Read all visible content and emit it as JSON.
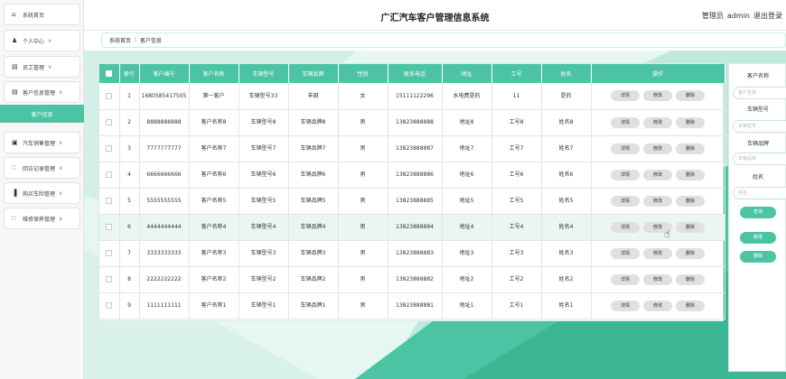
{
  "sidebar": {
    "items": [
      {
        "label": "系统首页",
        "icon": "home-icon",
        "glyph": "⌂",
        "chev": ""
      },
      {
        "label": "个人中心",
        "icon": "user-icon",
        "glyph": "♟",
        "chev": "∨"
      },
      {
        "label": "员工管理",
        "icon": "staff-icon",
        "glyph": "▤",
        "chev": "∨"
      },
      {
        "label": "客户信息管理",
        "icon": "customer-icon",
        "glyph": "▤",
        "chev": "∧"
      },
      {
        "label": "汽车销售管理",
        "icon": "car-sales-icon",
        "glyph": "▣",
        "chev": "∨"
      },
      {
        "label": "回访记录管理",
        "icon": "grid-icon",
        "glyph": "∷",
        "chev": "∨"
      },
      {
        "label": "购买车险管理",
        "icon": "chart-icon",
        "glyph": "▐",
        "chev": "∨"
      },
      {
        "label": "维修保养管理",
        "icon": "grid-icon",
        "glyph": "∷",
        "chev": "∨"
      }
    ],
    "active_sub": "客户信息"
  },
  "header": {
    "title": "广汇汽车客户管理信息系统",
    "role": "管理员",
    "username": "admin",
    "logout": "退出登录"
  },
  "breadcrumb": {
    "home": "系统首页",
    "sep": "|",
    "current": "客户信息"
  },
  "table": {
    "headers": [
      "索引",
      "客户编号",
      "客户名称",
      "车辆型号",
      "车辆品牌",
      "性别",
      "联系电话",
      "地址",
      "工号",
      "姓名",
      "操作"
    ],
    "actions": {
      "detail": "详情",
      "edit": "修改",
      "delete": "删除"
    },
    "rows": [
      [
        "1",
        "1680585417505",
        "第一客户",
        "车辆型号33",
        "丰田",
        "女",
        "15111122296",
        "水电费是的",
        "11",
        "是的"
      ],
      [
        "2",
        "8888888888",
        "客户名称8",
        "车辆型号8",
        "车辆品牌8",
        "男",
        "13823888888",
        "地址8",
        "工号8",
        "姓名8"
      ],
      [
        "3",
        "7777777777",
        "客户名称7",
        "车辆型号7",
        "车辆品牌7",
        "男",
        "13823888887",
        "地址7",
        "工号7",
        "姓名7"
      ],
      [
        "4",
        "6666666666",
        "客户名称6",
        "车辆型号6",
        "车辆品牌6",
        "男",
        "13823888886",
        "地址6",
        "工号6",
        "姓名6"
      ],
      [
        "5",
        "5555555555",
        "客户名称5",
        "车辆型号5",
        "车辆品牌5",
        "男",
        "13823888885",
        "地址5",
        "工号5",
        "姓名5"
      ],
      [
        "6",
        "4444444444",
        "客户名称4",
        "车辆型号4",
        "车辆品牌4",
        "男",
        "13823888884",
        "地址4",
        "工号4",
        "姓名4"
      ],
      [
        "7",
        "3333333333",
        "客户名称3",
        "车辆型号3",
        "车辆品牌3",
        "男",
        "13823888883",
        "地址3",
        "工号3",
        "姓名3"
      ],
      [
        "8",
        "2222222222",
        "客户名称2",
        "车辆型号2",
        "车辆品牌2",
        "男",
        "13823888882",
        "地址2",
        "工号2",
        "姓名2"
      ],
      [
        "9",
        "1111111111",
        "客户名称1",
        "车辆型号1",
        "车辆品牌1",
        "男",
        "13823888881",
        "地址1",
        "工号1",
        "姓名1"
      ]
    ]
  },
  "search": {
    "customer_name_label": "客户名称",
    "customer_name_placeholder": "客户名称",
    "model_label": "车辆型号",
    "model_placeholder": "车辆型号",
    "brand_label": "车辆品牌",
    "brand_placeholder": "车辆品牌",
    "name_label": "姓名",
    "name_placeholder": "姓名",
    "query_button": "查询",
    "add_button": "新增",
    "delete_button": "删除"
  },
  "colors": {
    "accent": "#4cc4a4",
    "background": "#e6f6f1"
  }
}
